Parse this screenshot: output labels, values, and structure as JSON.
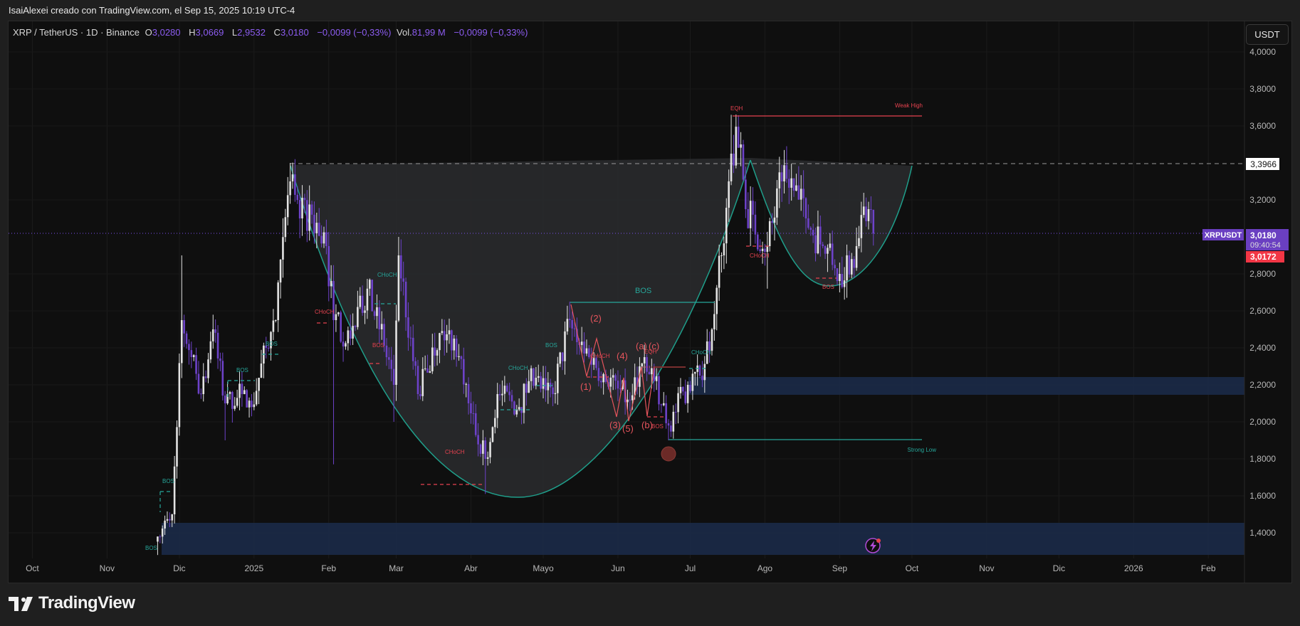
{
  "header": {
    "credit": "IsaiAlexei creado con TradingView.com, el Sep 15, 2025 10:19 UTC-4"
  },
  "legend": {
    "symbol": "XRP / TetherUS · 1D · Binance",
    "o_label": "O",
    "o": "3,0280",
    "h_label": "H",
    "h": "3,0669",
    "l_label": "L",
    "l": "2,9532",
    "c_label": "C",
    "c": "3,0180",
    "change": "−0,0099 (−0,33%)",
    "vol_label": "Vol.",
    "vol": "81,99 M",
    "vol_change": "−0,0099 (−0,33%)"
  },
  "price_axis": {
    "currency": "USDT",
    "ticks": [
      "4,0000",
      "3,8000",
      "3,6000",
      "3,2000",
      "2,8000",
      "2,6000",
      "2,4000",
      "2,2000",
      "2,0000",
      "1,8000",
      "1,6000",
      "1,4000"
    ],
    "tick_values": [
      4.0,
      3.8,
      3.6,
      3.2,
      2.8,
      2.6,
      2.4,
      2.2,
      2.0,
      1.8,
      1.6,
      1.4
    ],
    "level_label": "3,3966",
    "symbol_tag": "XRPUSDT",
    "last_price": "3,0180",
    "countdown": "09:40:54",
    "bid_price": "3,0172"
  },
  "time_axis": {
    "labels": [
      "Oct",
      "Nov",
      "Dic",
      "2025",
      "Feb",
      "Mar",
      "Abr",
      "Mayo",
      "Jun",
      "Jul",
      "Ago",
      "Sep",
      "Oct",
      "Nov",
      "Dic",
      "2026",
      "Feb"
    ],
    "dates": [
      "2024-10-01",
      "2024-11-01",
      "2024-12-01",
      "2025-01-01",
      "2025-02-01",
      "2025-03-01",
      "2025-04-01",
      "2025-05-01",
      "2025-06-01",
      "2025-07-01",
      "2025-08-01",
      "2025-09-01",
      "2025-10-01",
      "2025-11-01",
      "2025-12-01",
      "2026-01-01",
      "2026-02-01"
    ]
  },
  "annotations": {
    "bos": "BOS",
    "choch": "CHoCH",
    "eqh": "EQH",
    "weak_high": "Weak High",
    "strong_low": "Strong Low",
    "waves": [
      "(1)",
      "(2)",
      "(3)",
      "(4)",
      "(5)",
      "(a)",
      "(b)",
      "(c)"
    ]
  },
  "colors": {
    "up": "#e3e3e3",
    "down": "#6d42c9",
    "accent": "#6a3fc1",
    "bull": "#26a69a",
    "bear": "#e5424f",
    "zone": "#1b2a48"
  },
  "chart_data": {
    "type": "candlestick",
    "title": "XRP / TetherUS · 1D · Binance",
    "ylabel": "USDT",
    "ylim": [
      1.28,
      4.05
    ],
    "xlim": [
      "2024-09-22",
      "2026-02-20"
    ],
    "grid": true,
    "horizontal_levels": {
      "cup_rim": 3.3966,
      "weak_high": 3.66,
      "strong_low": 1.9,
      "last": 3.018
    },
    "zones": [
      {
        "from": 2.15,
        "to": 2.25,
        "start": "2025-06-25"
      },
      {
        "from": 1.28,
        "to": 1.46,
        "start": "2024-11-27"
      }
    ],
    "anchors": [
      {
        "date": "2024-11-22",
        "close": 1.38,
        "low": 1.28
      },
      {
        "date": "2024-11-28",
        "close": 1.5
      },
      {
        "date": "2024-12-02",
        "close": 2.55,
        "high": 2.9
      },
      {
        "date": "2024-12-06",
        "close": 2.35
      },
      {
        "date": "2024-12-10",
        "close": 2.15
      },
      {
        "date": "2024-12-15",
        "close": 2.5
      },
      {
        "date": "2024-12-20",
        "close": 2.1,
        "low": 1.9
      },
      {
        "date": "2024-12-27",
        "close": 2.15
      },
      {
        "date": "2024-12-31",
        "close": 2.08
      },
      {
        "date": "2025-01-06",
        "close": 2.4
      },
      {
        "date": "2025-01-10",
        "close": 2.55
      },
      {
        "date": "2025-01-16",
        "close": 3.3,
        "high": 3.4
      },
      {
        "date": "2025-01-20",
        "close": 3.1
      },
      {
        "date": "2025-01-25",
        "close": 3.12
      },
      {
        "date": "2025-01-31",
        "close": 2.95
      },
      {
        "date": "2025-02-03",
        "close": 2.55,
        "low": 1.77
      },
      {
        "date": "2025-02-10",
        "close": 2.45
      },
      {
        "date": "2025-02-17",
        "close": 2.72
      },
      {
        "date": "2025-02-22",
        "close": 2.5
      },
      {
        "date": "2025-02-28",
        "close": 2.2,
        "low": 2.0
      },
      {
        "date": "2025-03-02",
        "close": 2.9,
        "high": 3.0
      },
      {
        "date": "2025-03-10",
        "close": 2.15
      },
      {
        "date": "2025-03-19",
        "close": 2.48
      },
      {
        "date": "2025-03-25",
        "close": 2.45
      },
      {
        "date": "2025-03-31",
        "close": 2.1
      },
      {
        "date": "2025-04-07",
        "close": 1.8,
        "low": 1.61
      },
      {
        "date": "2025-04-12",
        "close": 2.15
      },
      {
        "date": "2025-04-21",
        "close": 2.08
      },
      {
        "date": "2025-04-25",
        "close": 2.22
      },
      {
        "date": "2025-05-05",
        "close": 2.15
      },
      {
        "date": "2025-05-12",
        "close": 2.55,
        "high": 2.65
      },
      {
        "date": "2025-05-20",
        "close": 2.35
      },
      {
        "date": "2025-06-01",
        "close": 2.18
      },
      {
        "date": "2025-06-05",
        "close": 2.12
      },
      {
        "date": "2025-06-10",
        "close": 2.3
      },
      {
        "date": "2025-06-16",
        "close": 2.22
      },
      {
        "date": "2025-06-22",
        "close": 1.98,
        "low": 1.9
      },
      {
        "date": "2025-06-30",
        "close": 2.2
      },
      {
        "date": "2025-07-05",
        "close": 2.25
      },
      {
        "date": "2025-07-10",
        "close": 2.5
      },
      {
        "date": "2025-07-14",
        "close": 2.9
      },
      {
        "date": "2025-07-18",
        "close": 3.45,
        "high": 3.66
      },
      {
        "date": "2025-07-22",
        "close": 3.5
      },
      {
        "date": "2025-07-24",
        "close": 3.15
      },
      {
        "date": "2025-08-02",
        "close": 2.95,
        "low": 2.72
      },
      {
        "date": "2025-08-08",
        "close": 3.3,
        "high": 3.39
      },
      {
        "date": "2025-08-13",
        "close": 3.25
      },
      {
        "date": "2025-08-18",
        "close": 3.1
      },
      {
        "date": "2025-08-25",
        "close": 2.95
      },
      {
        "date": "2025-09-01",
        "close": 2.8,
        "low": 2.7
      },
      {
        "date": "2025-09-08",
        "close": 2.95
      },
      {
        "date": "2025-09-13",
        "close": 3.15,
        "high": 3.19
      },
      {
        "date": "2025-09-15",
        "close": 3.018,
        "high": 3.0669,
        "low": 2.9532
      }
    ]
  }
}
